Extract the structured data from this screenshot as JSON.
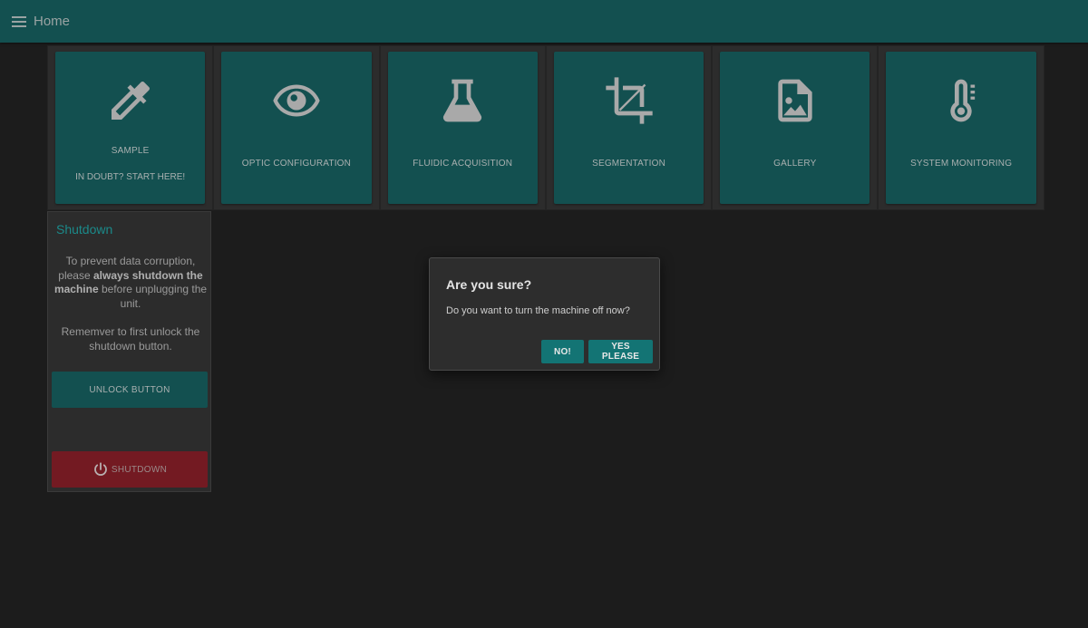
{
  "appbar": {
    "title": "Home",
    "menu_icon": "hamburger-menu-icon"
  },
  "tiles": [
    {
      "label": "SAMPLE",
      "sublabel": "IN DOUBT? START HERE!",
      "icon": "eyedropper-icon"
    },
    {
      "label": "OPTIC CONFIGURATION",
      "icon": "eye-icon"
    },
    {
      "label": "FLUIDIC ACQUISITION",
      "icon": "flask-icon"
    },
    {
      "label": "SEGMENTATION",
      "icon": "crop-icon"
    },
    {
      "label": "GALLERY",
      "icon": "image-file-icon"
    },
    {
      "label": "SYSTEM MONITORING",
      "icon": "thermometer-icon"
    }
  ],
  "shutdown": {
    "title": "Shutdown",
    "text_1_pre": "To prevent data corruption, please ",
    "text_1_bold": "always shutdown the machine",
    "text_1_post": " before unplugging the unit.",
    "text_2": "Rememver to first unlock the shutdown button.",
    "unlock_label": "UNLOCK BUTTON",
    "shutdown_label": "SHUTDOWN",
    "shutdown_icon": "power-icon"
  },
  "dialog": {
    "title": "Are you sure?",
    "body": "Do you want to turn the machine off now?",
    "no_label": "NO!",
    "yes_label": "YES PLEASE"
  },
  "colors": {
    "primary": "#135050",
    "accent_button": "#137474",
    "danger": "#731a22",
    "background": "#1c1c1c",
    "card": "#2c2c2c",
    "title_teal": "#1b8a8a"
  }
}
